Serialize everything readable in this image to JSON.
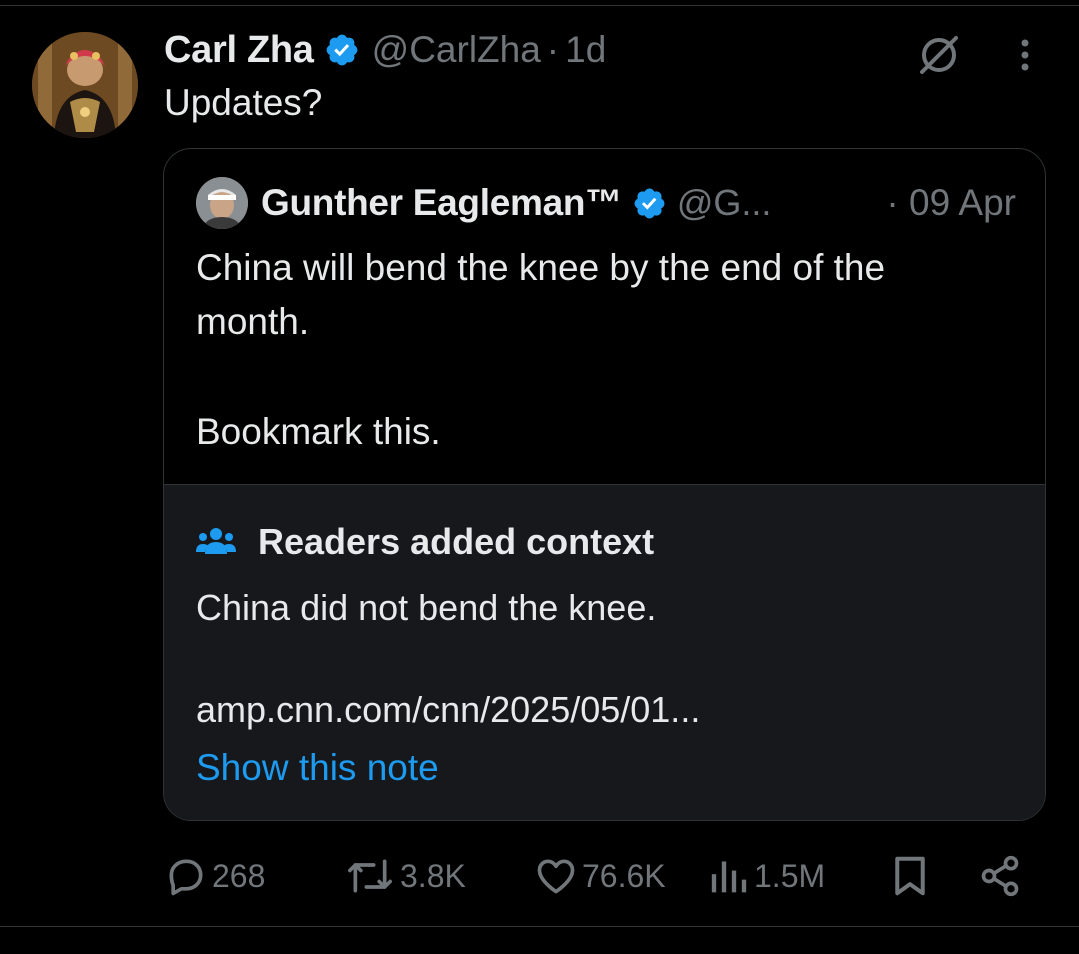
{
  "tweet": {
    "author": {
      "name": "Carl Zha",
      "handle": "@CarlZha",
      "time": "1d",
      "separator": "·"
    },
    "text": "Updates?",
    "icons": {
      "grok": "grok-icon",
      "more": "more-icon",
      "verified": "verified-badge-icon"
    }
  },
  "quote": {
    "author": {
      "name": "Gunther Eagleman™",
      "handle": "@G...",
      "time": "· 09 Apr"
    },
    "lines": [
      "China will bend the knee by the end of the",
      "month.",
      "Bookmark this."
    ]
  },
  "note": {
    "title": "Readers added context",
    "text": "China did not bend the knee.",
    "link": "amp.cnn.com/cnn/2025/05/01...",
    "show_label": "Show this note"
  },
  "actions": {
    "replies": "268",
    "reposts": "3.8K",
    "likes": "76.6K",
    "views": "1.5M"
  },
  "colors": {
    "background": "#000000",
    "text": "#e7e9ea",
    "muted": "#71767b",
    "accent": "#1d9bf0",
    "note_bg": "#16181c",
    "border": "#2f3336"
  }
}
